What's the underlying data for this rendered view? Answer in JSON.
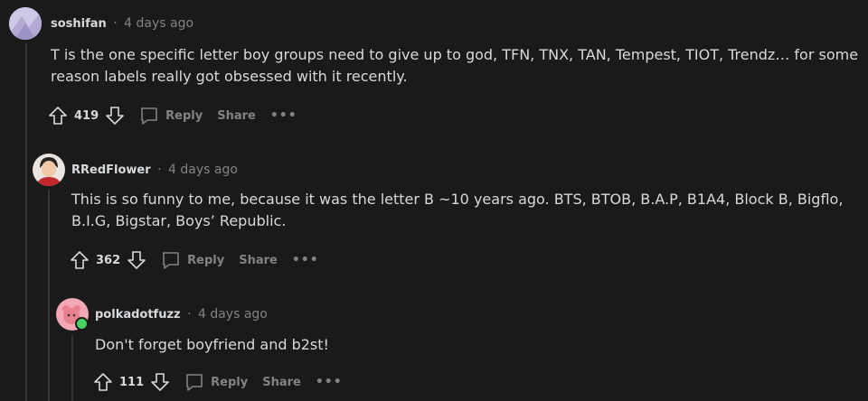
{
  "comments": [
    {
      "username": "soshifan",
      "time": "4 days ago",
      "body": "T is the one specific letter boy groups need to give up to god, TFN, TNX, TAN, Tempest, TIOT, Trendz… for some reason labels really got obsessed with it recently.",
      "score": "419",
      "reply_label": "Reply",
      "share_label": "Share",
      "more_label": "•••"
    },
    {
      "username": "RRedFlower",
      "time": "4 days ago",
      "body": "This is so funny to me, because it was the letter B ~10 years ago. BTS, BTOB, B.A.P, B1A4, Block B, Bigflo, B.I.G, Bigstar, Boys’ Republic.",
      "score": "362",
      "reply_label": "Reply",
      "share_label": "Share",
      "more_label": "•••"
    },
    {
      "username": "polkadotfuzz",
      "time": "4 days ago",
      "body": "Don't forget boyfriend and b2st!",
      "score": "111",
      "reply_label": "Reply",
      "share_label": "Share",
      "more_label": "•••"
    }
  ],
  "separator": "·",
  "colors": {
    "background": "#1a1a1b",
    "text": "#d7dadc",
    "muted": "#818384",
    "threadline": "#343536",
    "online": "#46d160"
  }
}
